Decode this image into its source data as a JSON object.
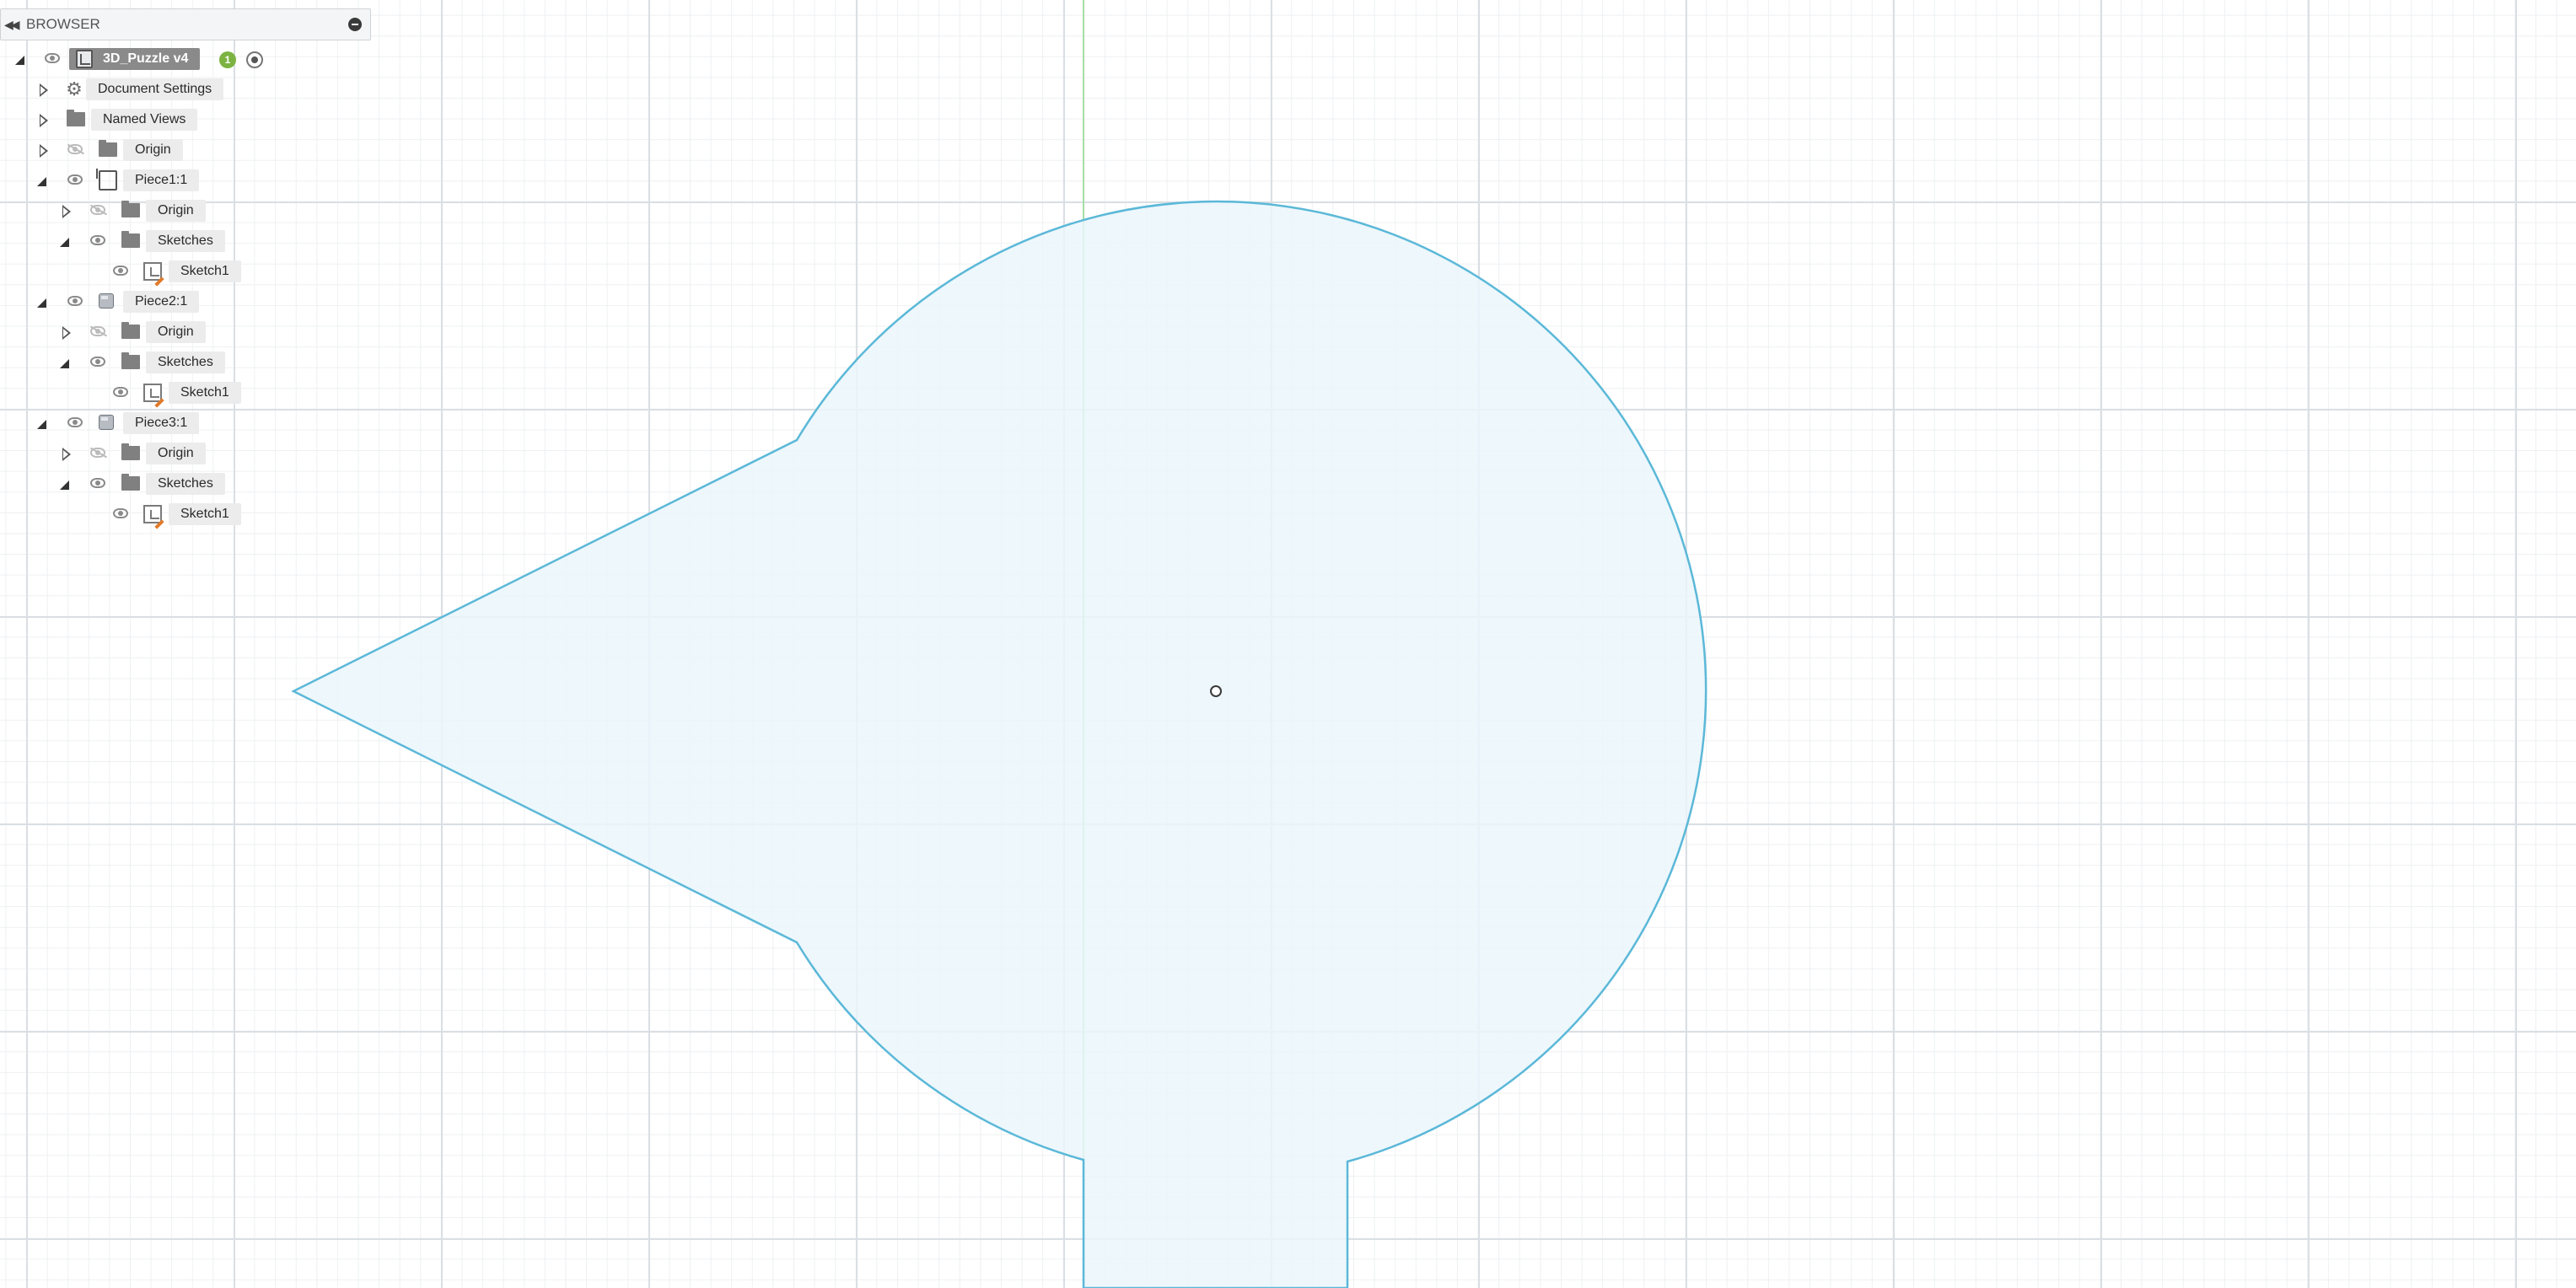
{
  "browser": {
    "title": "BROWSER",
    "root": {
      "label": "3D_Puzzle v4",
      "badge": "1"
    },
    "items": [
      {
        "label": "Document Settings"
      },
      {
        "label": "Named Views"
      },
      {
        "label": "Origin",
        "visible": false
      },
      {
        "label": "Piece1:1",
        "active": true
      },
      {
        "label": "Origin",
        "visible": false
      },
      {
        "label": "Sketches"
      },
      {
        "label": "Sketch1"
      },
      {
        "label": "Piece2:1"
      },
      {
        "label": "Origin",
        "visible": false
      },
      {
        "label": "Sketches"
      },
      {
        "label": "Sketch1"
      },
      {
        "label": "Piece3:1"
      },
      {
        "label": "Origin",
        "visible": false
      },
      {
        "label": "Sketches"
      },
      {
        "label": "Sketch1"
      }
    ]
  },
  "canvas": {
    "grid_major_color": "#dadfe4",
    "grid_minor_color": "#eef0f2",
    "axis_color": "#a6dfa6",
    "profile_stroke_color": "#5bb8d8",
    "profile_fill_color": "#eaf6fc",
    "center_point_color": "#3a3a3a"
  }
}
